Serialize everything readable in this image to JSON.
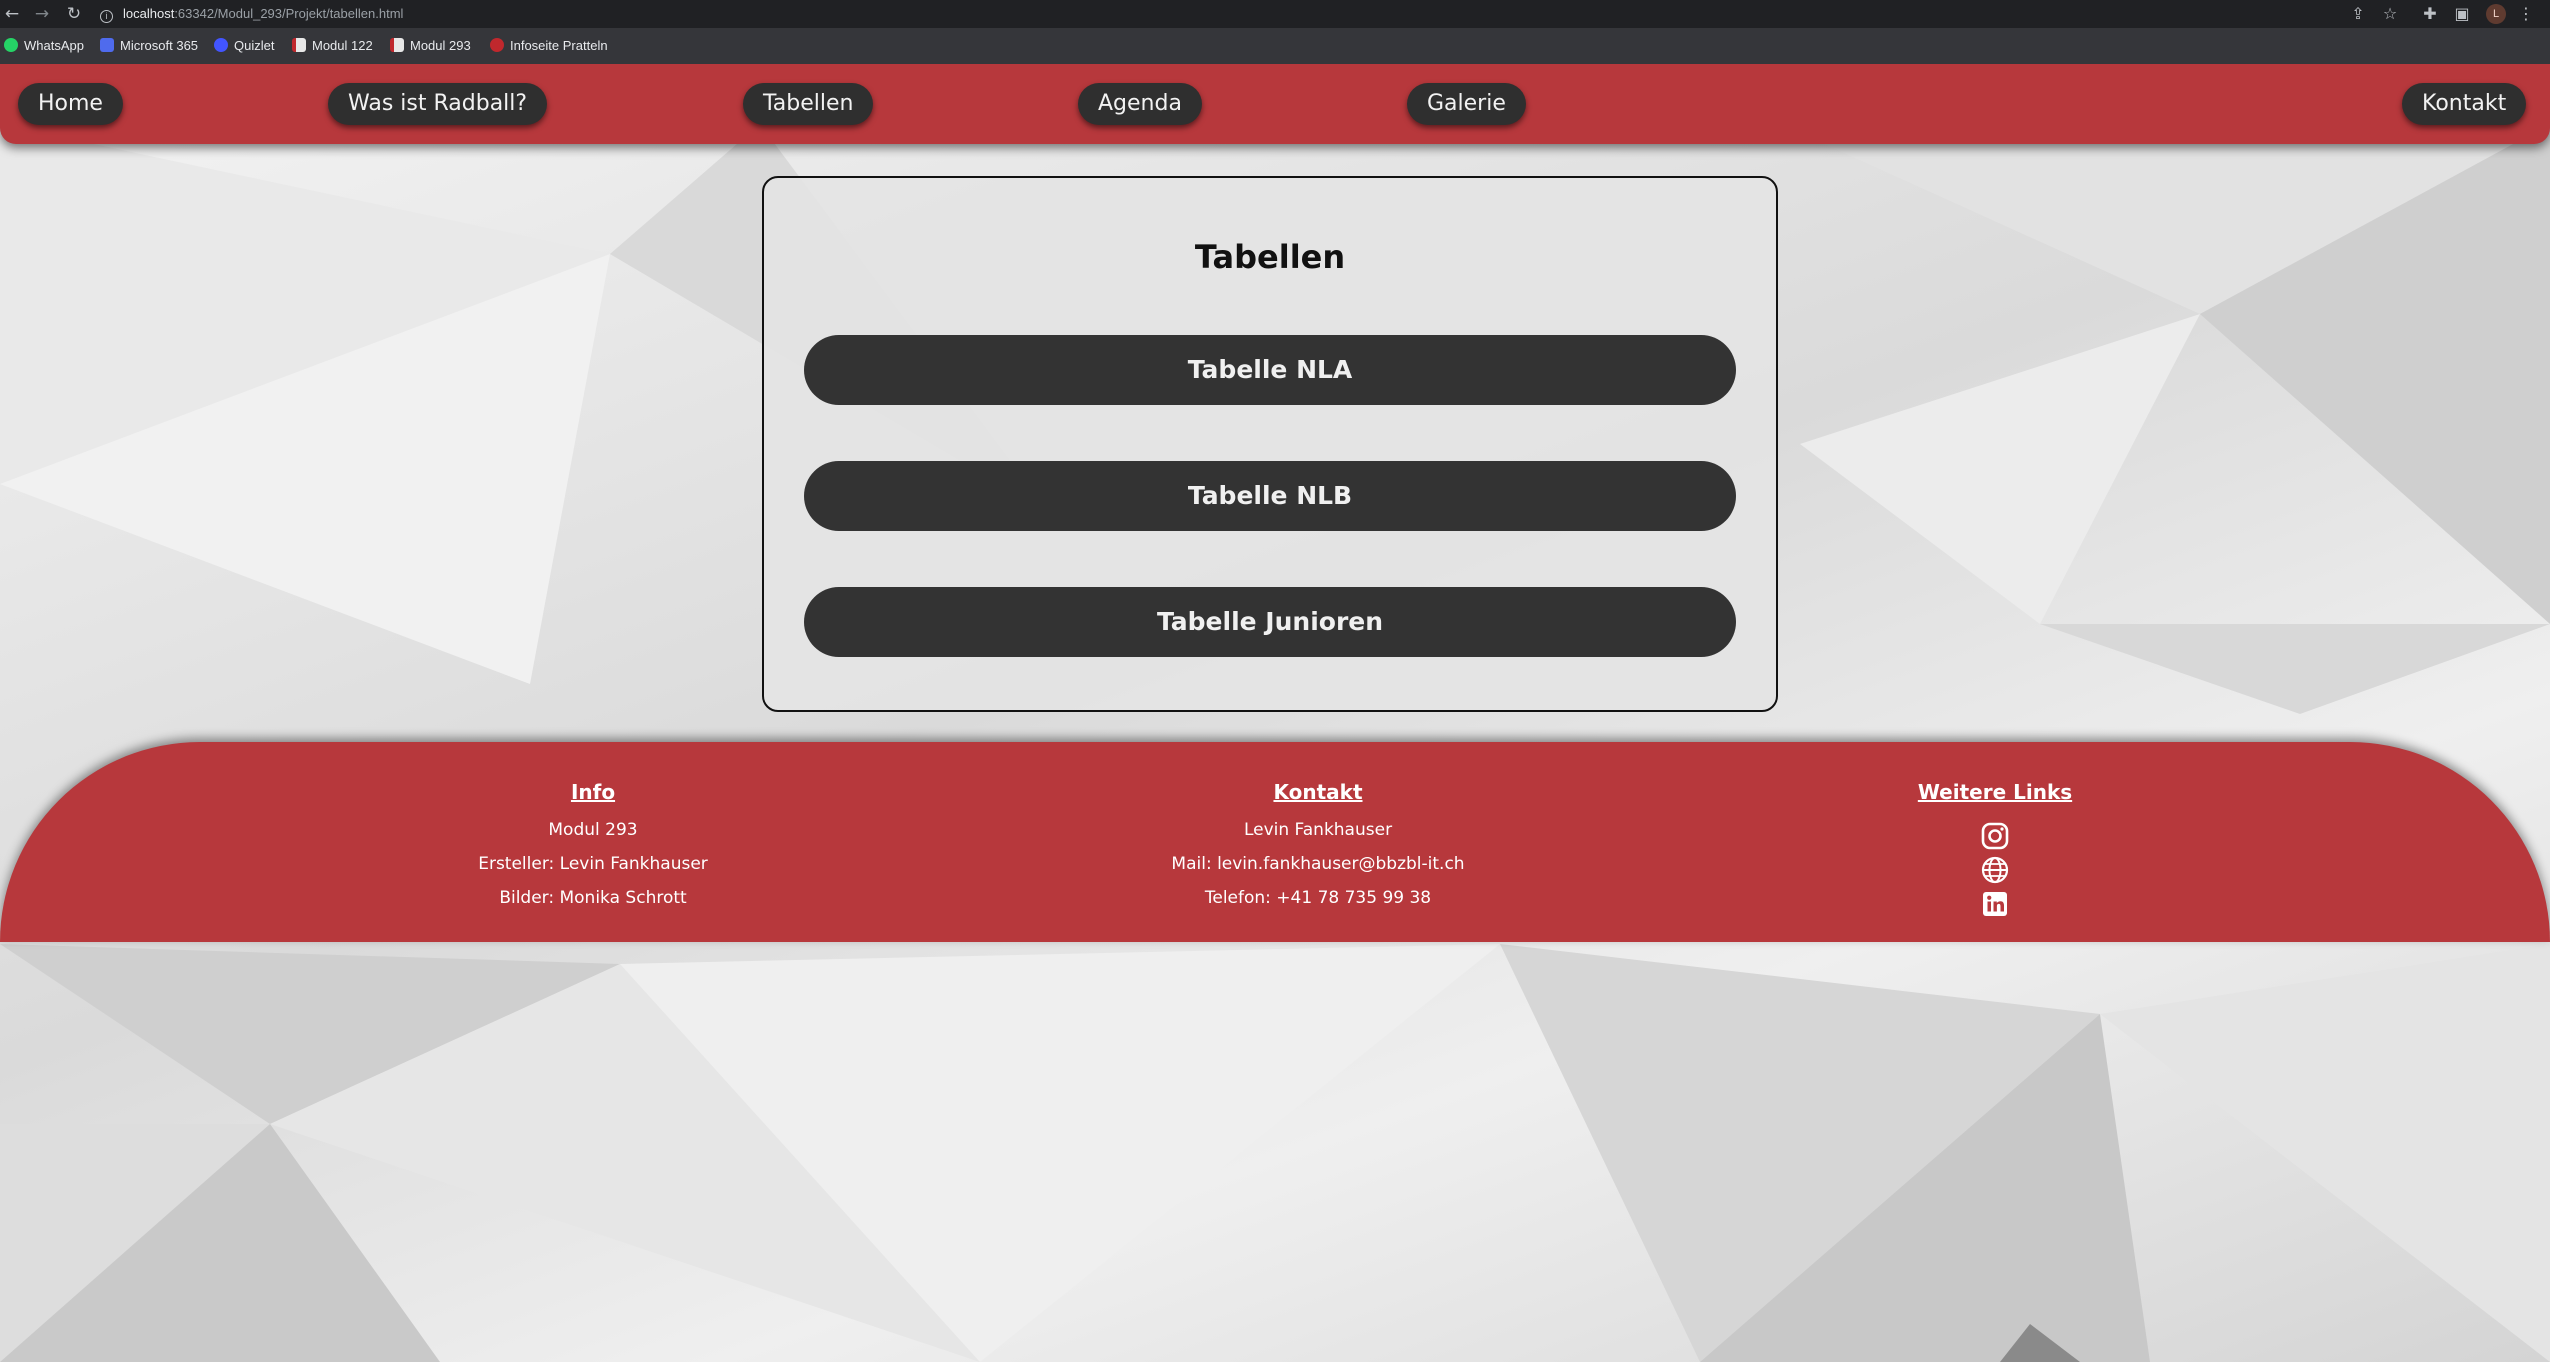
{
  "browser": {
    "url_host": "localhost",
    "url_rest": ":63342/Modul_293/Projekt/tabellen.html",
    "avatar_letter": "L",
    "bookmarks": [
      {
        "label": "WhatsApp",
        "color": "#25d366"
      },
      {
        "label": "Microsoft 365",
        "color": "#4f6bed"
      },
      {
        "label": "Quizlet",
        "color": "#4255ff"
      },
      {
        "label": "Modul 122",
        "color": "#e8e8e8"
      },
      {
        "label": "Modul 293",
        "color": "#e8e8e8"
      },
      {
        "label": "Infoseite Pratteln",
        "color": "#c0282d"
      }
    ]
  },
  "nav": {
    "home": "Home",
    "radball": "Was ist Radball?",
    "tabellen": "Tabellen",
    "agenda": "Agenda",
    "galerie": "Galerie",
    "kontakt": "Kontakt"
  },
  "main": {
    "title": "Tabellen",
    "buttons": [
      "Tabelle NLA",
      "Tabelle NLB",
      "Tabelle Junioren"
    ]
  },
  "footer": {
    "info": {
      "heading": "Info",
      "lines": [
        "Modul 293",
        "Ersteller: Levin Fankhauser",
        "Bilder: Monika Schrott"
      ]
    },
    "kontakt": {
      "heading": "Kontakt",
      "lines": [
        "Levin Fankhauser",
        "Mail: levin.fankhauser@bbzbl-it.ch",
        "Telefon: +41 78 735 99 38"
      ]
    },
    "links": {
      "heading": "Weitere Links",
      "icons": [
        "instagram-icon",
        "globe-icon",
        "linkedin-icon"
      ]
    }
  },
  "colors": {
    "accent_red": "#b7383c",
    "button_dark": "#333333"
  }
}
